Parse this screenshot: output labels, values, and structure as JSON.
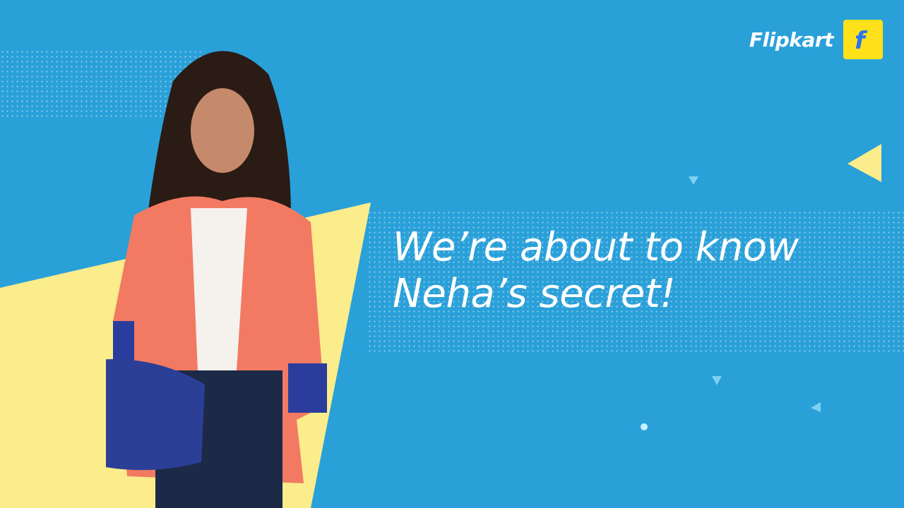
{
  "brand": {
    "name": "Flipkart",
    "logo_icon": "flipkart-bag-icon"
  },
  "headline": {
    "line1": "We’re about to know",
    "line2": "Neha’s secret!"
  },
  "colors": {
    "background": "#2aa0d9",
    "accent_yellow": "#fbec8c",
    "logo_yellow": "#ffe11b"
  }
}
